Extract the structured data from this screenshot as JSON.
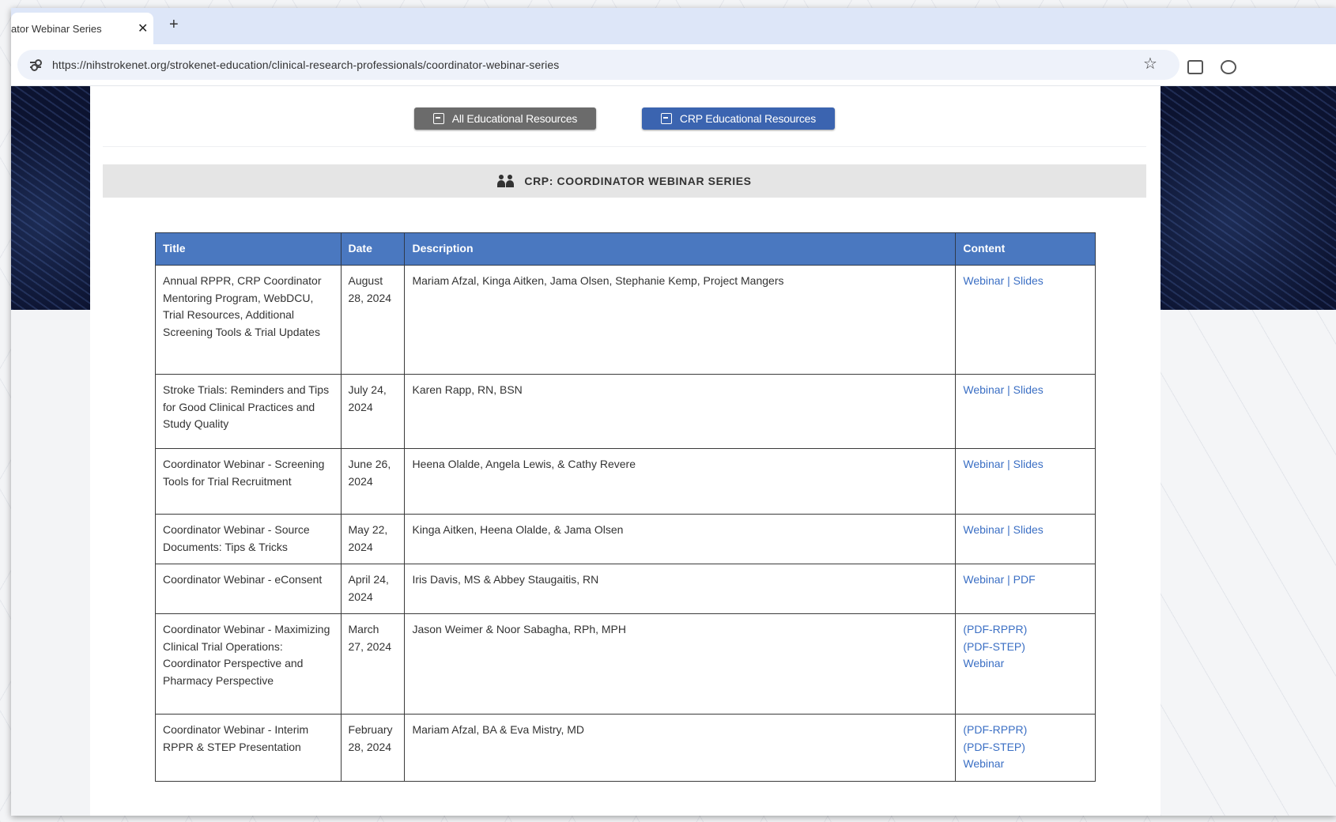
{
  "browser": {
    "tab_title": "ator Webinar Series",
    "close_glyph": "✕",
    "new_tab_glyph": "+",
    "url": "https://nihstrokenet.org/strokenet-education/clinical-research-professionals/coordinator-webinar-series",
    "bookmark_glyph": "☆"
  },
  "buttons": {
    "all_resources": "All Educational Resources",
    "crp_resources": "CRP Educational Resources"
  },
  "section": {
    "title": "CRP: COORDINATOR WEBINAR SERIES"
  },
  "table": {
    "headers": [
      "Title",
      "Date",
      "Description",
      "Content"
    ],
    "rows": [
      {
        "title": "Annual RPPR, CRP Coordinator Mentoring Program, WebDCU, Trial Resources, Additional Screening Tools & Trial Updates",
        "date": "August 28, 2024",
        "description": "Mariam Afzal, Kinga Aitken, Jama Olsen, Stephanie Kemp, Project Mangers",
        "links": [
          "Webinar",
          "Slides"
        ]
      },
      {
        "title": "Stroke Trials: Reminders and Tips for Good Clinical Practices and Study Quality",
        "date": "July 24, 2024",
        "description": "Karen Rapp, RN, BSN",
        "links": [
          "Webinar",
          "Slides"
        ]
      },
      {
        "title": "Coordinator Webinar - Screening Tools for Trial Recruitment",
        "date": "June 26, 2024",
        "description": "Heena Olalde, Angela Lewis, & Cathy Revere",
        "links": [
          "Webinar",
          "Slides"
        ]
      },
      {
        "title": "Coordinator Webinar - Source Documents: Tips & Tricks",
        "date": "May 22, 2024",
        "description": "Kinga Aitken, Heena Olalde, & Jama Olsen",
        "links": [
          "Webinar",
          "Slides"
        ]
      },
      {
        "title": "Coordinator Webinar - eConsent",
        "date": "April 24, 2024",
        "description": "Iris Davis, MS & Abbey Staugaitis, RN",
        "links": [
          "Webinar",
          "PDF"
        ]
      },
      {
        "title": "Coordinator Webinar - Maximizing Clinical Trial Operations: Coordinator Perspective and Pharmacy Perspective",
        "date": "March 27, 2024",
        "description": "Jason Weimer & Noor Sabagha, RPh, MPH",
        "links": [
          "(PDF-RPPR)",
          "(PDF-STEP)",
          "Webinar"
        ]
      },
      {
        "title": "Coordinator Webinar - Interim RPPR & STEP Presentation",
        "date": "February 28, 2024",
        "description": "Mariam Afzal, BA & Eva Mistry, MD",
        "links": [
          "(PDF-RPPR)",
          "(PDF-STEP)",
          "Webinar"
        ]
      }
    ]
  }
}
